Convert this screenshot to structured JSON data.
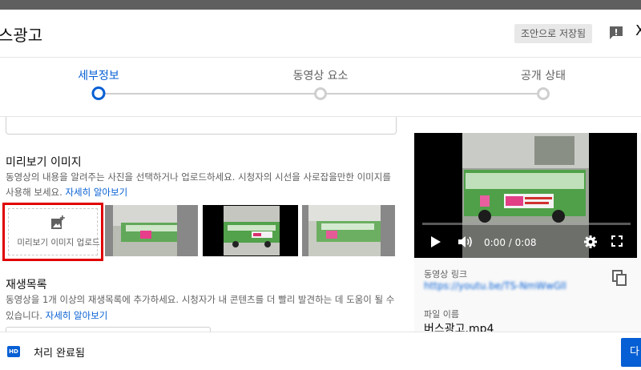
{
  "header": {
    "title": "스광고",
    "save_draft": "조안으로 저장됨",
    "close_glyph": "X"
  },
  "stepper": {
    "steps": [
      {
        "label": "세부정보",
        "active": true
      },
      {
        "label": "동영상 요소",
        "active": false
      },
      {
        "label": "공개 상태",
        "active": false
      }
    ]
  },
  "thumbnail": {
    "title": "미리보기 이미지",
    "description": "동영상의 내용을 알려주는 사진을 선택하거나 업로드하세요. 시청자의 시선을 사로잡을만한 이미지를 사용해 보세요.",
    "learn_more": "자세히 알아보기",
    "upload_label": "미리보기 이미지 업로드",
    "upload_icon": "add-photo-icon"
  },
  "playlist": {
    "title": "재생목록",
    "description": "동영상을 1개 이상의 재생목록에 추가하세요. 시청자가 내 콘텐츠를 더 빨리 발견하는 데 도움이 될 수 있습니다.",
    "learn_more": "자세히 알아보기"
  },
  "player": {
    "time": "0:00 / 0:08",
    "progress": 0
  },
  "video_info": {
    "link_label": "동영상 링크",
    "link_value": "https://youtu.be/TS-NmWwGll",
    "file_label": "파일 이름",
    "file_value": "버스광고.mp4"
  },
  "footer": {
    "hd_badge": "HD",
    "status": "처리 완료됨",
    "next_label": "다"
  },
  "colors": {
    "accent": "#065fd4",
    "highlight_border": "#e00000",
    "bus_green": "#4fa048"
  }
}
